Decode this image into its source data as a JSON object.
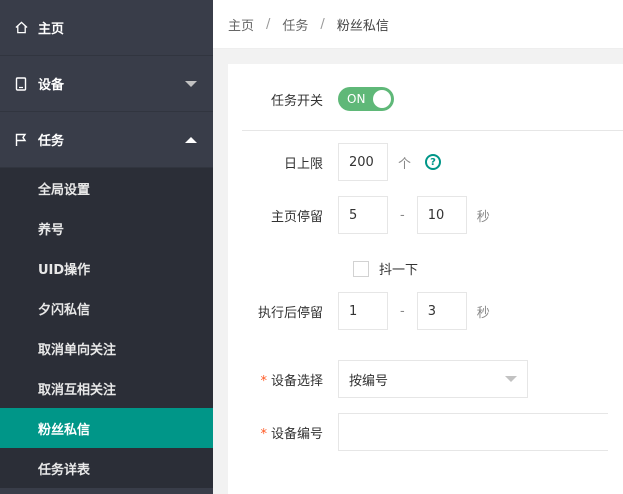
{
  "sidebar": {
    "home": {
      "label": "主页",
      "icon": "home-icon"
    },
    "device": {
      "label": "设备",
      "icon": "tablet-icon"
    },
    "task": {
      "label": "任务",
      "icon": "flag-icon"
    },
    "task_items": [
      {
        "label": "全局设置"
      },
      {
        "label": "养号"
      },
      {
        "label": "UID操作"
      },
      {
        "label": "夕闪私信"
      },
      {
        "label": "取消单向关注"
      },
      {
        "label": "取消互相关注"
      },
      {
        "label": "粉丝私信",
        "active": true
      },
      {
        "label": "任务详表"
      }
    ],
    "bg_color": "#393d49",
    "active_color": "#009688"
  },
  "breadcrumb": {
    "items": [
      "主页",
      "任务",
      "粉丝私信"
    ],
    "separator": "/"
  },
  "form": {
    "task_switch": {
      "label": "任务开关",
      "state": "ON"
    },
    "daily_limit": {
      "label": "日上限",
      "value": "200",
      "unit": "个",
      "help": "?"
    },
    "home_stay": {
      "label": "主页停留",
      "min": "5",
      "max": "10",
      "unit": "秒",
      "dash": "-"
    },
    "shake": {
      "label": "抖一下",
      "checked": false
    },
    "post_stay": {
      "label": "执行后停留",
      "min": "1",
      "max": "3",
      "unit": "秒",
      "dash": "-"
    },
    "device_select": {
      "label": "设备选择",
      "required_mark": "*",
      "value": "按编号"
    },
    "device_number": {
      "label": "设备编号",
      "required_mark": "*",
      "value": ""
    }
  }
}
